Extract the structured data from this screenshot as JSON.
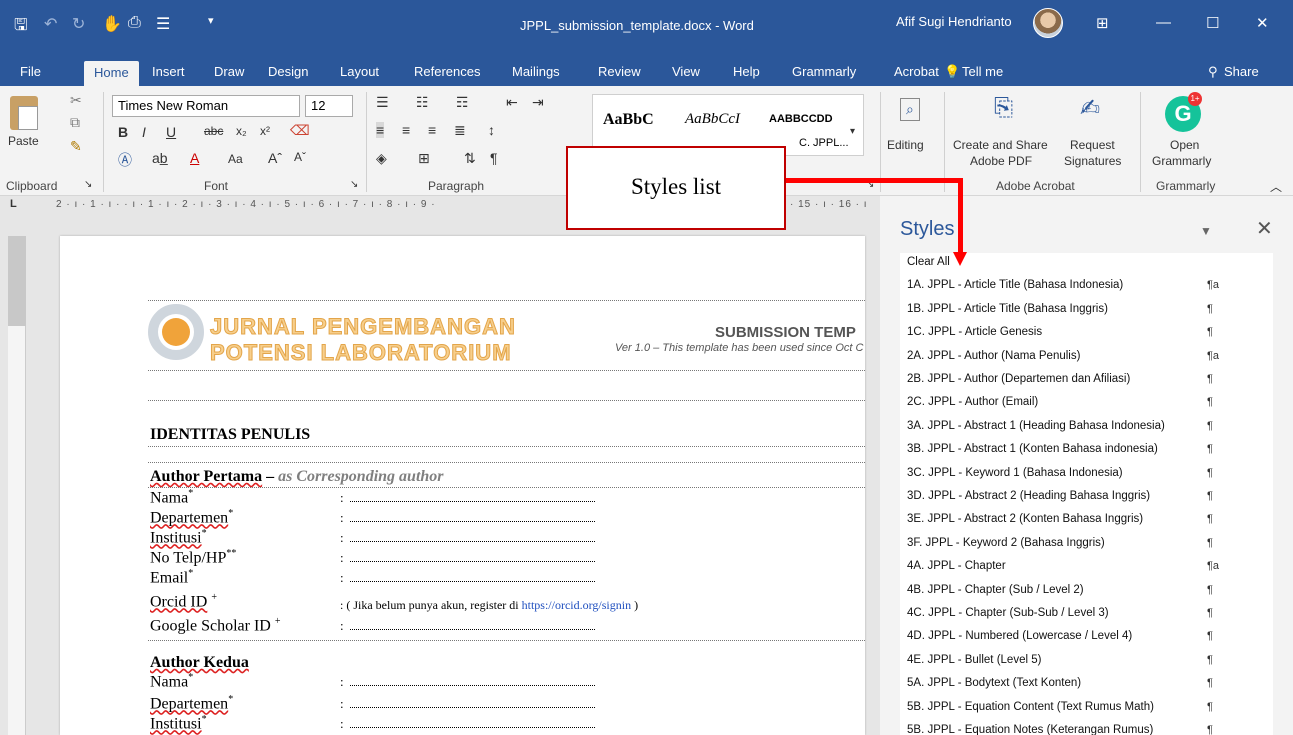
{
  "window": {
    "title": "JPPL_submission_template.docx - Word",
    "user": "Afif Sugi Hendrianto"
  },
  "tabs": [
    "File",
    "Home",
    "Insert",
    "Draw",
    "Design",
    "Layout",
    "References",
    "Mailings",
    "Review",
    "View",
    "Help",
    "Grammarly",
    "Acrobat",
    "Tell me",
    "Share"
  ],
  "ribbon": {
    "font_name": "Times New Roman",
    "font_size": "12",
    "paste": "Paste",
    "groups": [
      "Clipboard",
      "Font",
      "Paragraph",
      "Adobe Acrobat",
      "Grammarly"
    ],
    "style_samples": [
      "AaBbC",
      "AaBbCcI",
      "AABBCCDD"
    ],
    "style_caption": "C. JPPL...",
    "editing": "Editing",
    "create_share_1": "Create and Share",
    "create_share_2": "Adobe PDF",
    "request_1": "Request",
    "request_2": "Signatures",
    "open_1": "Open",
    "open_2": "Grammarly"
  },
  "ruler": "2 · ı · 1 · ı ·   · ı · 1 · ı · 2 · ı · 3 · ı · 4 · ı · 5 · ı · 6 · ı · 7 · ı · 8 · ı · 9 ·",
  "ruler_right": "· 15 · ı · 16 · ı",
  "document": {
    "journal_1": "JURNAL PENGEMBANGAN",
    "journal_2": "POTENSI LABORATORIUM",
    "submission": "SUBMISSION TEMP",
    "version": "Ver 1.0 – This template has been used since Oct C",
    "identitas": "IDENTITAS PENULIS",
    "author1": "Author Pertama",
    "dash": " – ",
    "corresponding": "as Corresponding author",
    "fields": [
      "Nama",
      "Departemen",
      "Institusi",
      "No Telp/HP",
      "Email",
      "Orcid ID",
      "Google Scholar ID"
    ],
    "field_marks": [
      "*",
      "*",
      "*",
      "**",
      "*",
      "+",
      "+"
    ],
    "orcid_note": ": ( Jika belum punya akun, register di ",
    "orcid_link": "https://orcid.org/signin",
    "orcid_end": " )",
    "author2": "Author Kedua",
    "fields2": [
      "Nama",
      "Departemen",
      "Institusi"
    ],
    "field_marks2": [
      "*",
      "*",
      "*"
    ]
  },
  "styles_pane": {
    "title": "Styles",
    "items": [
      {
        "label": "Clear All",
        "mark": ""
      },
      {
        "label": "1A. JPPL - Article Title (Bahasa Indonesia)",
        "mark": "¶a"
      },
      {
        "label": "1B. JPPL - Article Title (Bahasa Inggris)",
        "mark": "¶"
      },
      {
        "label": "1C. JPPL - Article Genesis",
        "mark": "¶"
      },
      {
        "label": "2A. JPPL - Author (Nama Penulis)",
        "mark": "¶a"
      },
      {
        "label": "2B. JPPL - Author (Departemen dan Afiliasi)",
        "mark": "¶"
      },
      {
        "label": "2C. JPPL - Author (Email)",
        "mark": "¶"
      },
      {
        "label": "3A. JPPL - Abstract 1 (Heading Bahasa Indonesia)",
        "mark": "¶"
      },
      {
        "label": "3B. JPPL - Abstract 1 (Konten Bahasa indonesia)",
        "mark": "¶"
      },
      {
        "label": "3C. JPPL - Keyword 1 (Bahasa Indonesia)",
        "mark": "¶"
      },
      {
        "label": "3D. JPPL - Abstract 2 (Heading Bahasa Inggris)",
        "mark": "¶"
      },
      {
        "label": "3E. JPPL - Abstract 2 (Konten Bahasa Inggris)",
        "mark": "¶"
      },
      {
        "label": "3F. JPPL - Keyword 2  (Bahasa Inggris)",
        "mark": "¶"
      },
      {
        "label": "4A. JPPL - Chapter",
        "mark": "¶a"
      },
      {
        "label": "4B. JPPL - Chapter (Sub / Level 2)",
        "mark": "¶"
      },
      {
        "label": "4C. JPPL - Chapter (Sub-Sub / Level 3)",
        "mark": "¶"
      },
      {
        "label": "4D. JPPL - Numbered (Lowercase / Level 4)",
        "mark": "¶"
      },
      {
        "label": "4E. JPPL - Bullet (Level 5)",
        "mark": "¶"
      },
      {
        "label": "5A. JPPL - Bodytext (Text Konten)",
        "mark": "¶"
      },
      {
        "label": "5B. JPPL - Equation Content (Text Rumus Math)",
        "mark": "¶"
      },
      {
        "label": "5B. JPPL - Equation Notes (Keterangan Rumus)",
        "mark": "¶"
      }
    ]
  },
  "callout": {
    "text": "Styles list"
  },
  "colors": {
    "word_blue": "#2b579a",
    "annotation_red": "#ff0000"
  }
}
